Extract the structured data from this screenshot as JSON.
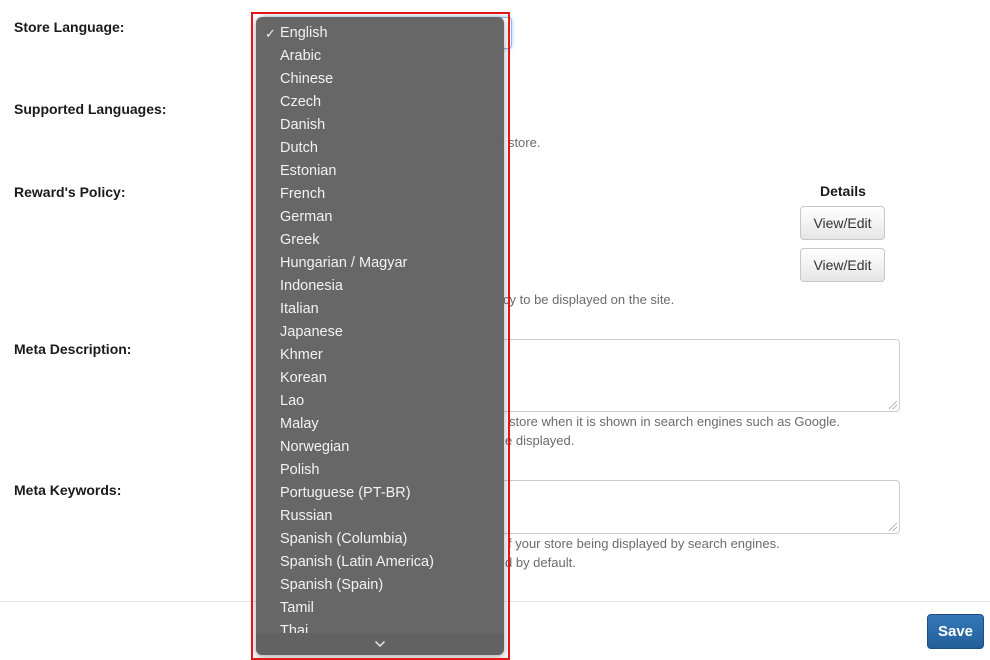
{
  "form": {
    "store_language": {
      "label": "Store Language:",
      "selected": "English",
      "options": [
        "English",
        "Arabic",
        "Chinese",
        "Czech",
        "Danish",
        "Dutch",
        "Estonian",
        "French",
        "German",
        "Greek",
        "Hungarian / Magyar",
        "Indonesia",
        "Italian",
        "Japanese",
        "Khmer",
        "Korean",
        "Lao",
        "Malay",
        "Norwegian",
        "Polish",
        "Portuguese (PT-BR)",
        "Russian",
        "Spanish (Columbia)",
        "Spanish (Latin America)",
        "Spanish (Spain)",
        "Tamil",
        "Thai"
      ],
      "check_icon": "checkmark-icon",
      "scroll_icon": "chevron-down-icon"
    },
    "supported_languages": {
      "label": "Supported Languages:",
      "help_fragment": "r store."
    },
    "rewards_policy": {
      "label": "Reward's Policy:",
      "details_header": "Details",
      "buttons": [
        "View/Edit",
        "View/Edit"
      ],
      "help_fragment": "cy to be displayed on the site."
    },
    "meta_description": {
      "label": "Meta Description:",
      "value": "",
      "help_line1": "store when it is shown in search engines such as Google.",
      "help_line2": "e displayed."
    },
    "meta_keywords": {
      "label": "Meta Keywords:",
      "value": "",
      "help_line1": "f your store being displayed by search engines.",
      "help_line2": "d by default."
    }
  },
  "footer": {
    "save_label": "Save"
  }
}
